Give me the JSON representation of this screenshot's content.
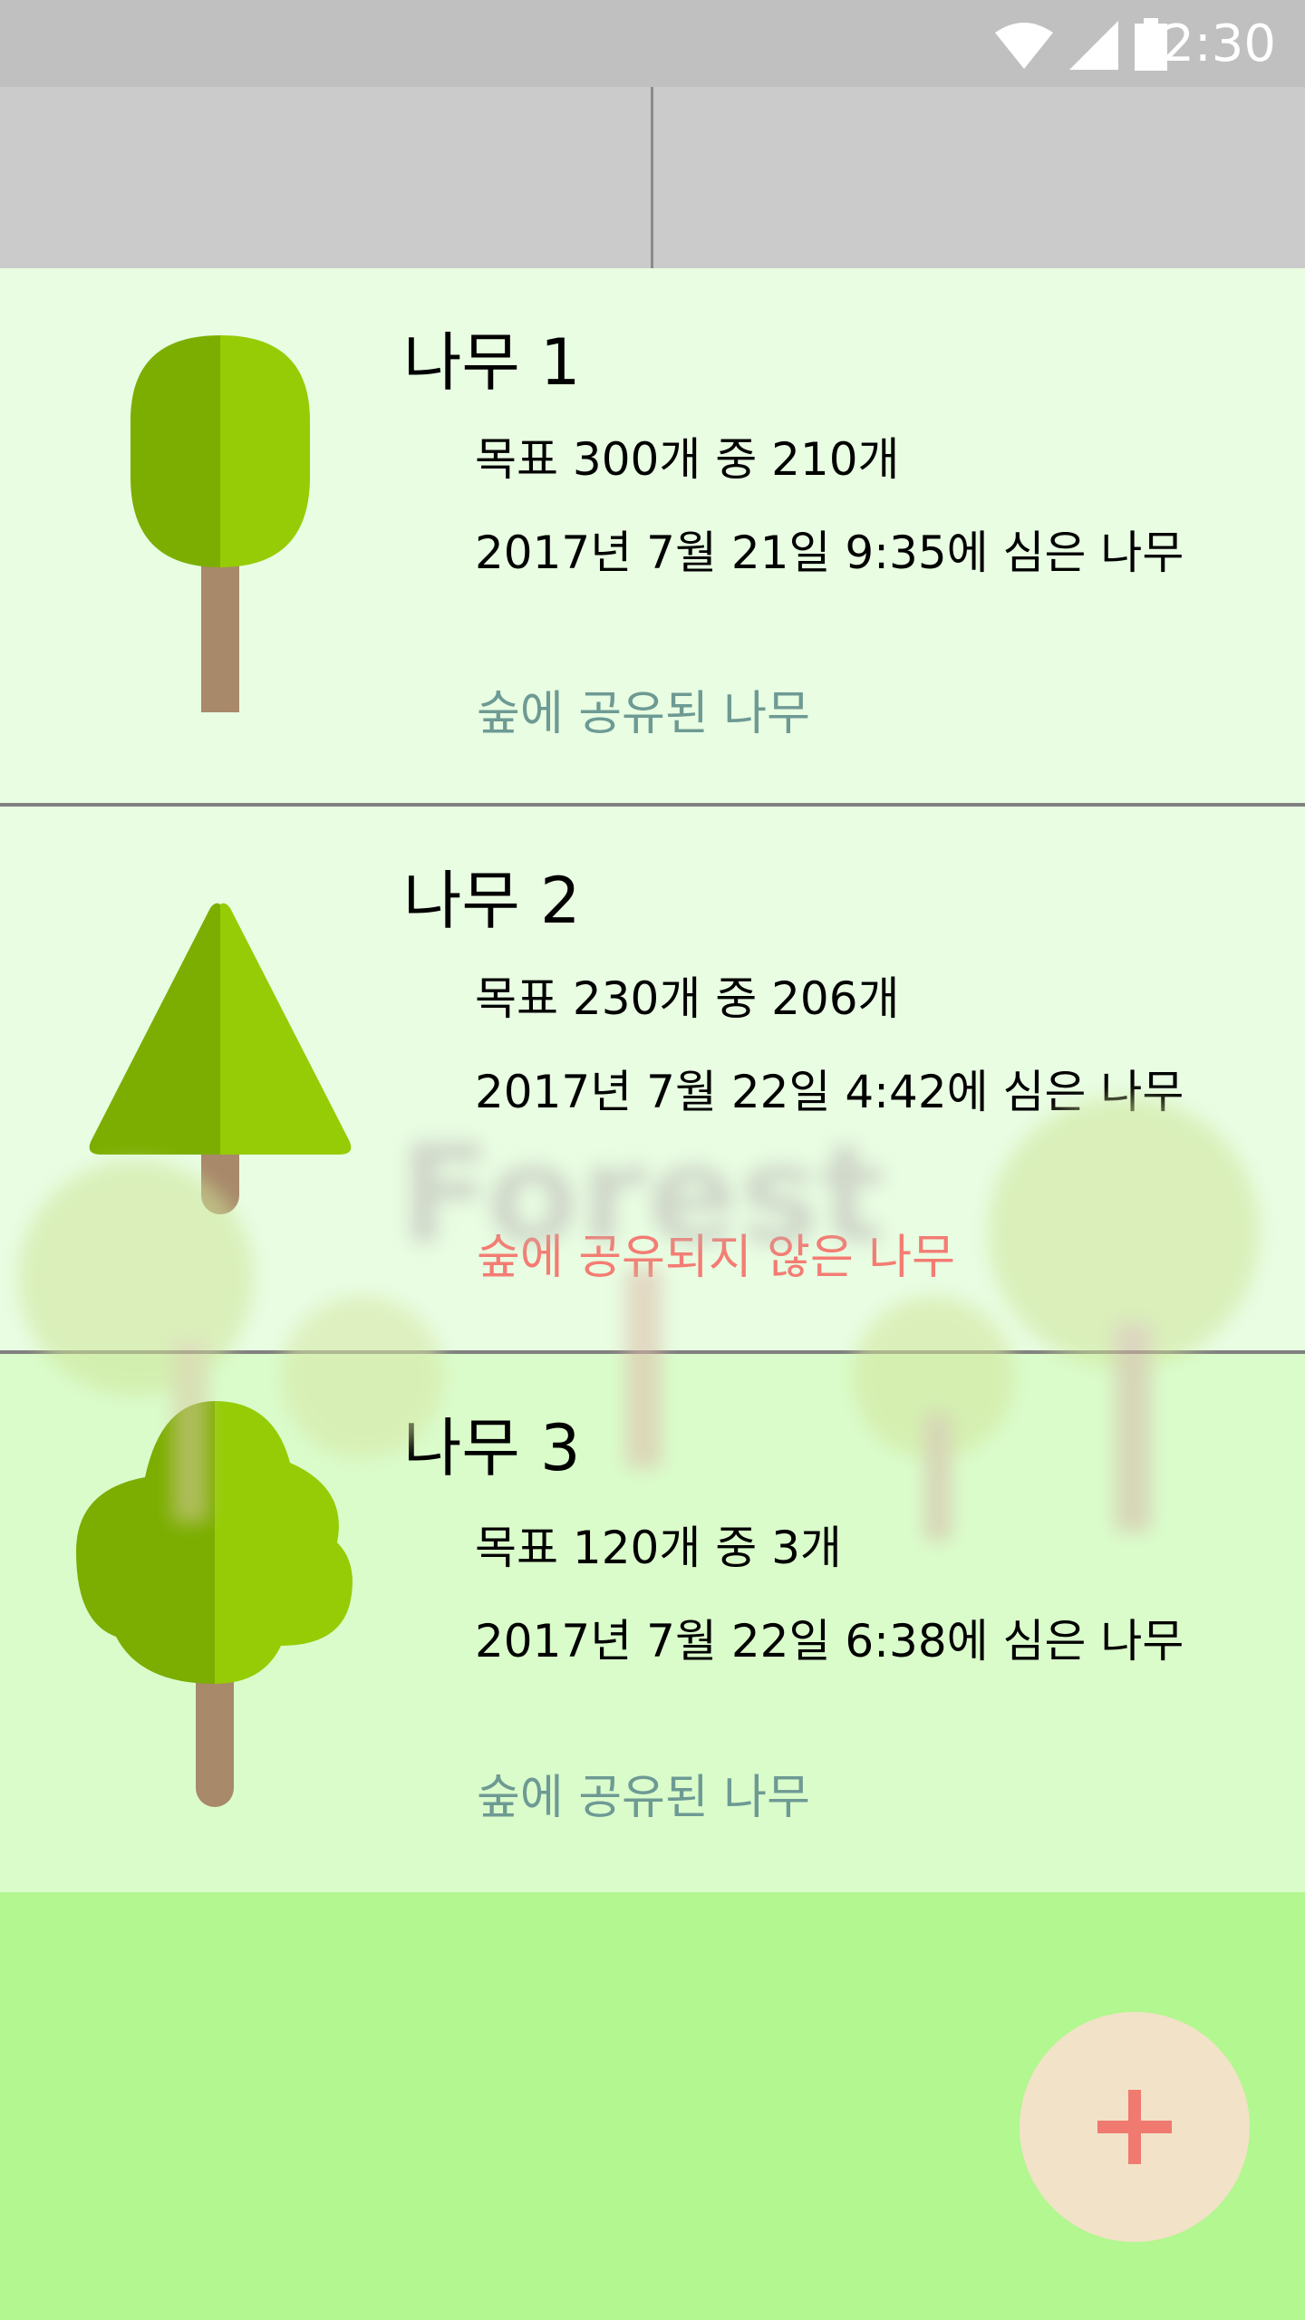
{
  "status_bar": {
    "time": "12:30",
    "icons": [
      "wifi-icon",
      "cellular-signal-icon",
      "battery-icon"
    ]
  },
  "watermark": {
    "text": "Forest"
  },
  "trees": [
    {
      "title": "나무 1",
      "goal": "목표 300개 중 210개",
      "planted": "2017년 7월 21일 9:35에 심은 나무",
      "share_status": "숲에 공유된 나무",
      "shared": true,
      "icon": "round-tree-icon"
    },
    {
      "title": "나무 2",
      "goal": "목표 230개 중 206개",
      "planted": "2017년 7월 22일 4:42에 심은 나무",
      "share_status": "숲에 공유되지 않은 나무",
      "shared": false,
      "icon": "pine-tree-icon"
    },
    {
      "title": "나무 3",
      "goal": "목표 120개 중 3개",
      "planted": "2017년 7월 22일 6:38에 심은 나무",
      "share_status": "숲에 공유된 나무",
      "shared": true,
      "icon": "bushy-tree-icon"
    }
  ],
  "colors": {
    "background": "#b2f78f",
    "card_background": "#e8fde2",
    "card_background_last": "#dafccb",
    "shared_text": "#6e9a94",
    "not_shared_text": "#f47c73",
    "fab_background": "#f2e2c8",
    "fab_icon": "#f07a6f"
  },
  "fab": {
    "icon": "plus-icon"
  }
}
